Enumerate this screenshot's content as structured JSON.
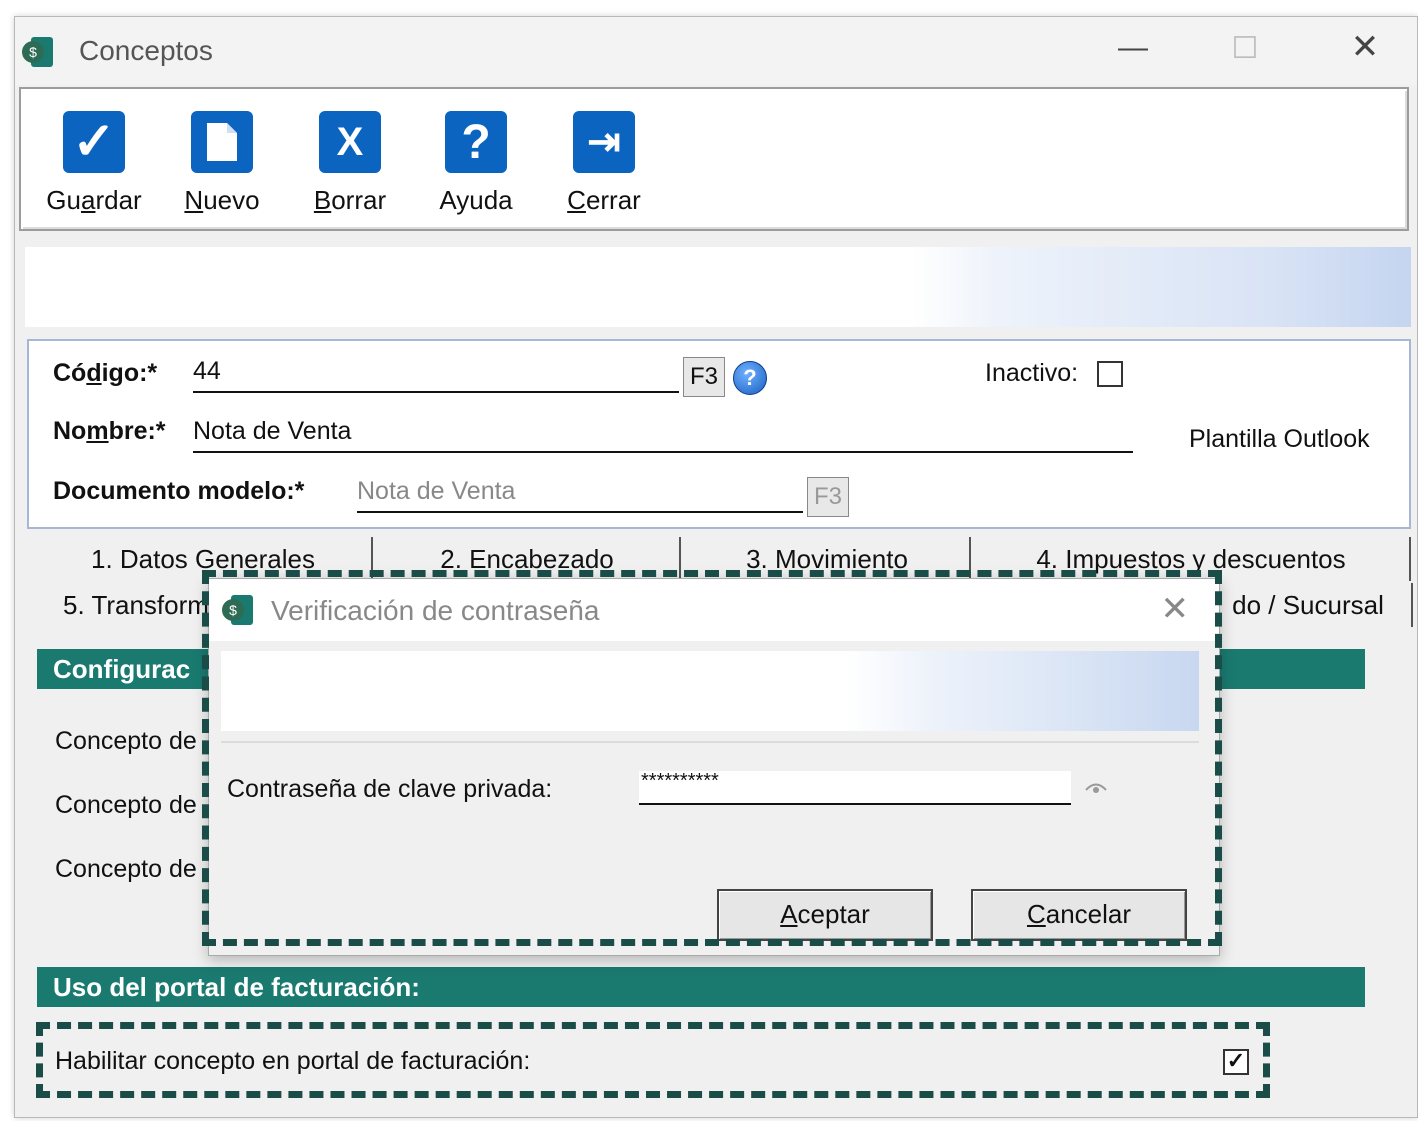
{
  "window": {
    "title": "Conceptos",
    "min": "—",
    "max": "☐",
    "close": "✕"
  },
  "toolbar": {
    "buttons": [
      {
        "icon": "check-icon",
        "glyph": "✓",
        "pre": "Gu",
        "u": "a",
        "post": "rdar"
      },
      {
        "icon": "new-document-icon",
        "glyph": "",
        "pre": "",
        "u": "N",
        "post": "uevo"
      },
      {
        "icon": "delete-x-icon",
        "glyph": "X",
        "pre": "",
        "u": "B",
        "post": "orrar"
      },
      {
        "icon": "help-question-icon",
        "glyph": "?",
        "pre": "Ayuda",
        "u": "",
        "post": ""
      },
      {
        "icon": "exit-door-icon",
        "glyph": "⇥",
        "pre": "",
        "u": "C",
        "post": "errar"
      }
    ]
  },
  "form": {
    "codigo_label_pre": "Có",
    "codigo_label_u": "d",
    "codigo_label_post": "igo:*",
    "codigo_value": "44",
    "f3": "F3",
    "help": "?",
    "inactivo_label": "Inactivo:",
    "nombre_label_pre": "No",
    "nombre_label_u": "m",
    "nombre_label_post": "bre:*",
    "nombre_value": "Nota de Venta",
    "plantilla": "Plantilla Outlook",
    "docmodelo_label": "Documento modelo:*",
    "docmodelo_value": "Nota de Venta"
  },
  "tabs": {
    "row1": [
      "1. Datos Generales",
      "2. Encabezado",
      "3. Movimiento",
      "4. Impuestos y descuentos"
    ],
    "row2_left": "5. Transform",
    "row2_right": "do / Sucursal"
  },
  "content": {
    "config_header": "Configurac",
    "rows": [
      "Concepto de",
      "Concepto de",
      "Concepto de"
    ],
    "portal_header": "Uso del portal de facturación:",
    "portal_option": "Habilitar concepto en portal de facturación:",
    "portal_checked": true
  },
  "dialog": {
    "title": "Verificación de contraseña",
    "close": "✕",
    "password_label": "Contraseña de clave privada:",
    "password_value": "**********",
    "accept_u": "A",
    "accept_rest": "ceptar",
    "cancel_u": "C",
    "cancel_rest": "ancelar"
  },
  "colors": {
    "accent": "#1a7a70",
    "toolbar_icon": "#0b64c0",
    "dash_border": "#1b4d48"
  }
}
